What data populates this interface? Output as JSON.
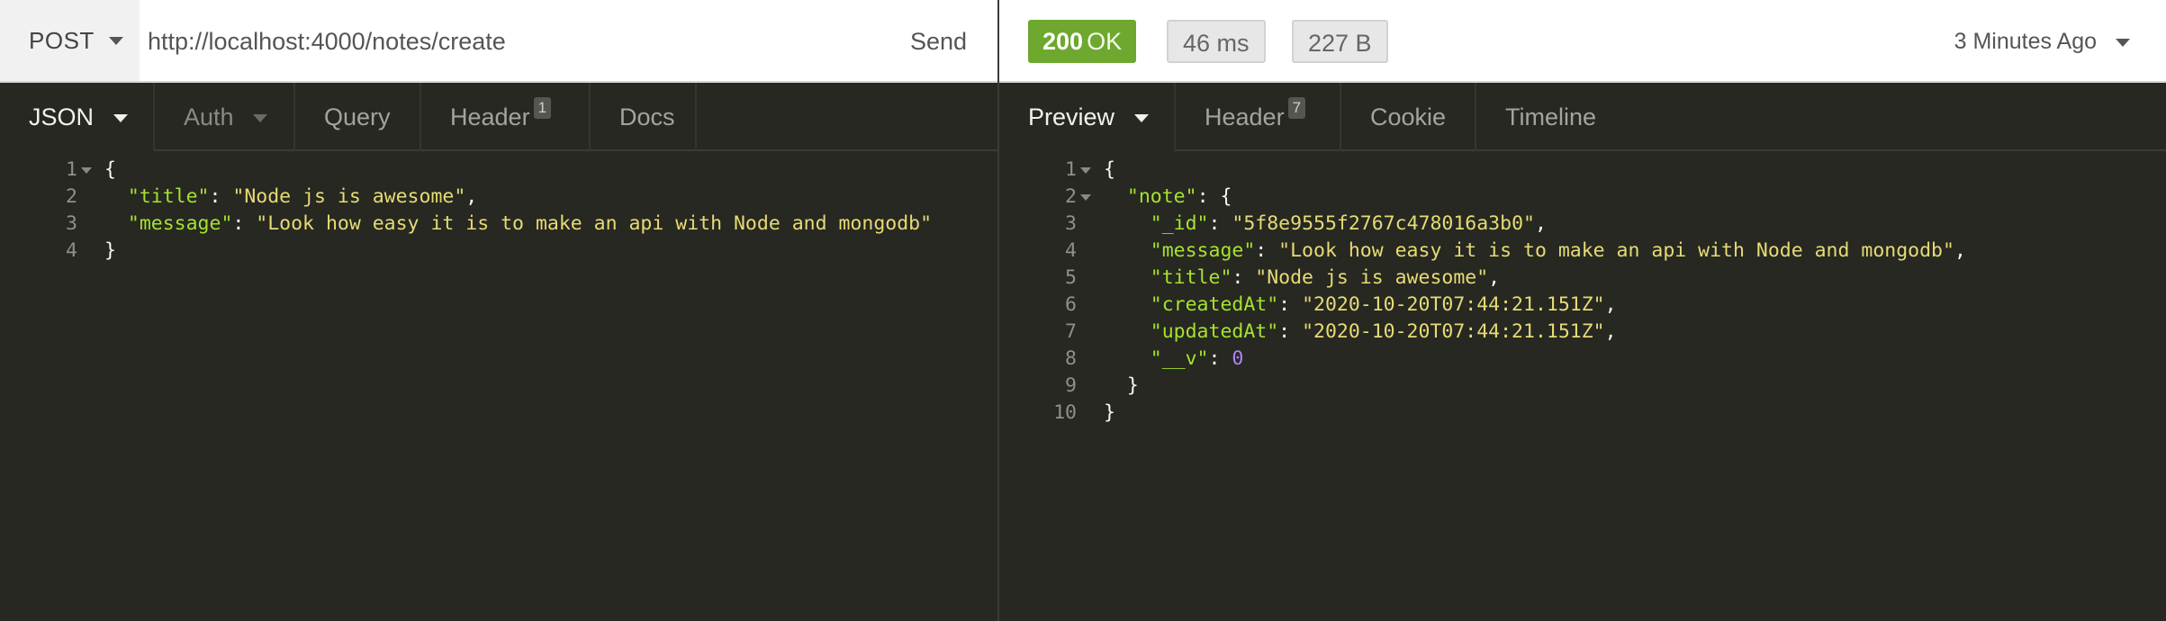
{
  "request": {
    "method": "POST",
    "url": "http://localhost:4000/notes/create",
    "send_label": "Send",
    "tabs": [
      {
        "label": "JSON"
      },
      {
        "label": "Auth"
      },
      {
        "label": "Query"
      },
      {
        "label": "Header",
        "count": "1"
      },
      {
        "label": "Docs"
      }
    ],
    "body_lines": [
      {
        "n": "1",
        "fold": true,
        "indent": "",
        "tokens": [
          {
            "t": "{",
            "c": "p"
          }
        ]
      },
      {
        "n": "2",
        "indent": "  ",
        "tokens": [
          {
            "t": "\"title\"",
            "c": "k"
          },
          {
            "t": ": ",
            "c": "p"
          },
          {
            "t": "\"Node js is awesome\"",
            "c": "s"
          },
          {
            "t": ",",
            "c": "p"
          }
        ]
      },
      {
        "n": "3",
        "indent": "  ",
        "tokens": [
          {
            "t": "\"message\"",
            "c": "k"
          },
          {
            "t": ": ",
            "c": "p"
          },
          {
            "t": "\"Look how easy it is to make an api with Node and mongodb\"",
            "c": "s"
          }
        ]
      },
      {
        "n": "4",
        "indent": "",
        "tokens": [
          {
            "t": "}",
            "c": "p"
          }
        ]
      }
    ]
  },
  "response": {
    "status_code": "200",
    "status_text": "OK",
    "time": "46 ms",
    "size": "227 B",
    "time_ago": "3 Minutes Ago",
    "tabs": [
      {
        "label": "Preview"
      },
      {
        "label": "Header",
        "count": "7"
      },
      {
        "label": "Cookie"
      },
      {
        "label": "Timeline"
      }
    ],
    "body_lines": [
      {
        "n": "1",
        "fold": true,
        "indent": "",
        "tokens": [
          {
            "t": "{",
            "c": "p"
          }
        ]
      },
      {
        "n": "2",
        "fold": true,
        "indent": "  ",
        "tokens": [
          {
            "t": "\"note\"",
            "c": "k"
          },
          {
            "t": ": {",
            "c": "p"
          }
        ]
      },
      {
        "n": "3",
        "indent": "    ",
        "tokens": [
          {
            "t": "\"_id\"",
            "c": "k"
          },
          {
            "t": ": ",
            "c": "p"
          },
          {
            "t": "\"5f8e9555f2767c478016a3b0\"",
            "c": "s"
          },
          {
            "t": ",",
            "c": "p"
          }
        ]
      },
      {
        "n": "4",
        "indent": "    ",
        "tokens": [
          {
            "t": "\"message\"",
            "c": "k"
          },
          {
            "t": ": ",
            "c": "p"
          },
          {
            "t": "\"Look how easy it is to make an api with Node and mongodb\"",
            "c": "s"
          },
          {
            "t": ",",
            "c": "p"
          }
        ]
      },
      {
        "n": "5",
        "indent": "    ",
        "tokens": [
          {
            "t": "\"title\"",
            "c": "k"
          },
          {
            "t": ": ",
            "c": "p"
          },
          {
            "t": "\"Node js is awesome\"",
            "c": "s"
          },
          {
            "t": ",",
            "c": "p"
          }
        ]
      },
      {
        "n": "6",
        "indent": "    ",
        "tokens": [
          {
            "t": "\"createdAt\"",
            "c": "k"
          },
          {
            "t": ": ",
            "c": "p"
          },
          {
            "t": "\"2020-10-20T07:44:21.151Z\"",
            "c": "s"
          },
          {
            "t": ",",
            "c": "p"
          }
        ]
      },
      {
        "n": "7",
        "indent": "    ",
        "tokens": [
          {
            "t": "\"updatedAt\"",
            "c": "k"
          },
          {
            "t": ": ",
            "c": "p"
          },
          {
            "t": "\"2020-10-20T07:44:21.151Z\"",
            "c": "s"
          },
          {
            "t": ",",
            "c": "p"
          }
        ]
      },
      {
        "n": "8",
        "indent": "    ",
        "tokens": [
          {
            "t": "\"__v\"",
            "c": "k"
          },
          {
            "t": ": ",
            "c": "p"
          },
          {
            "t": "0",
            "c": "n"
          }
        ]
      },
      {
        "n": "9",
        "indent": "  ",
        "tokens": [
          {
            "t": "}",
            "c": "p"
          }
        ]
      },
      {
        "n": "10",
        "indent": "",
        "tokens": [
          {
            "t": "}",
            "c": "p"
          }
        ]
      }
    ]
  },
  "colors": {
    "editor_bg": "#272822",
    "key": "#a6e22e",
    "string": "#e6db74",
    "number": "#ae81ff",
    "status_ok": "#6ea82f"
  },
  "icons": {
    "dropdown": "chevron-down-icon",
    "fold": "fold-arrow-icon"
  }
}
